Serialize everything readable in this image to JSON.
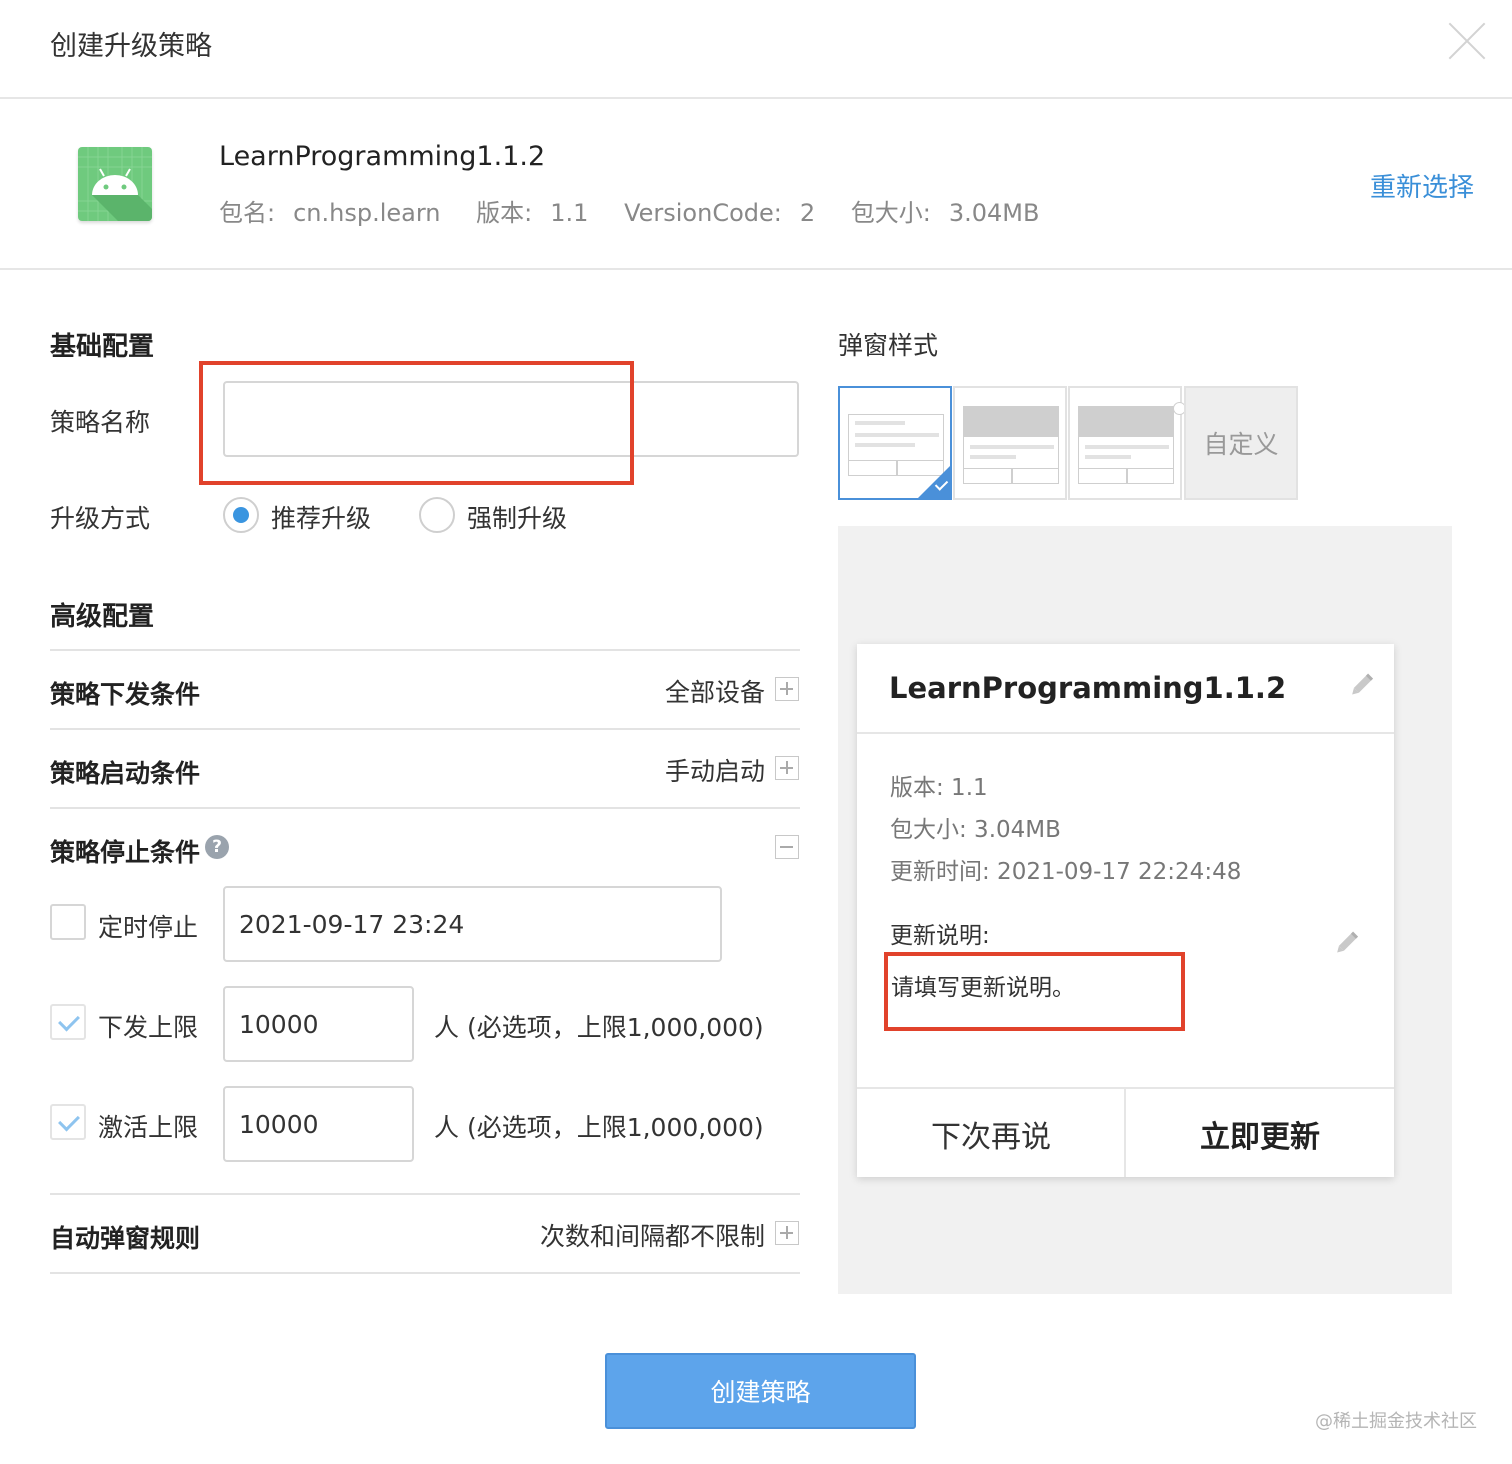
{
  "dialog": {
    "title": "创建升级策略"
  },
  "app": {
    "name": "LearnProgramming1.1.2",
    "meta": [
      {
        "label": "包名:",
        "value": "cn.hsp.learn"
      },
      {
        "label": "版本:",
        "value": "1.1"
      },
      {
        "label": "VersionCode:",
        "value": "2"
      },
      {
        "label": "包大小:",
        "value": "3.04MB"
      }
    ],
    "reselect": "重新选择"
  },
  "basic": {
    "title": "基础配置",
    "name_label": "策略名称",
    "name_value": "",
    "mode_label": "升级方式",
    "modes": [
      "推荐升级",
      "强制升级"
    ],
    "selected_mode": "推荐升级"
  },
  "advanced": {
    "title": "高级配置",
    "dispatch": {
      "label": "策略下发条件",
      "value": "全部设备"
    },
    "start": {
      "label": "策略启动条件",
      "value": "手动启动"
    },
    "stop": {
      "label": "策略停止条件",
      "help": "?",
      "timed_label": "定时停止",
      "timed_checked": false,
      "timed_value": "2021-09-17 23:24",
      "dispatch_limit_label": "下发上限",
      "dispatch_limit_checked": true,
      "dispatch_limit_value": "10000",
      "dispatch_limit_hint": "人 (必选项，上限1,000,000)",
      "activate_limit_label": "激活上限",
      "activate_limit_checked": true,
      "activate_limit_value": "10000",
      "activate_limit_hint": "人 (必选项，上限1,000,000)"
    },
    "popup_rule": {
      "label": "自动弹窗规则",
      "value": "次数和间隔都不限制"
    }
  },
  "popup_style": {
    "title": "弹窗样式",
    "custom_label": "自定义",
    "selected_index": 0
  },
  "preview": {
    "title": "LearnProgramming1.1.2",
    "version": "版本: 1.1",
    "size": "包大小: 3.04MB",
    "update_time": "更新时间: 2021-09-17 22:24:48",
    "notes_label": "更新说明:",
    "notes_placeholder": "请填写更新说明。",
    "later": "下次再说",
    "update_now": "立即更新"
  },
  "footer": {
    "create": "创建策略",
    "watermark": "@稀土掘金技术社区"
  },
  "colors": {
    "accent": "#3a8fd8",
    "primary_button": "#5da4eb",
    "highlight_box": "#e1422b",
    "app_icon": "#6fca7e"
  }
}
